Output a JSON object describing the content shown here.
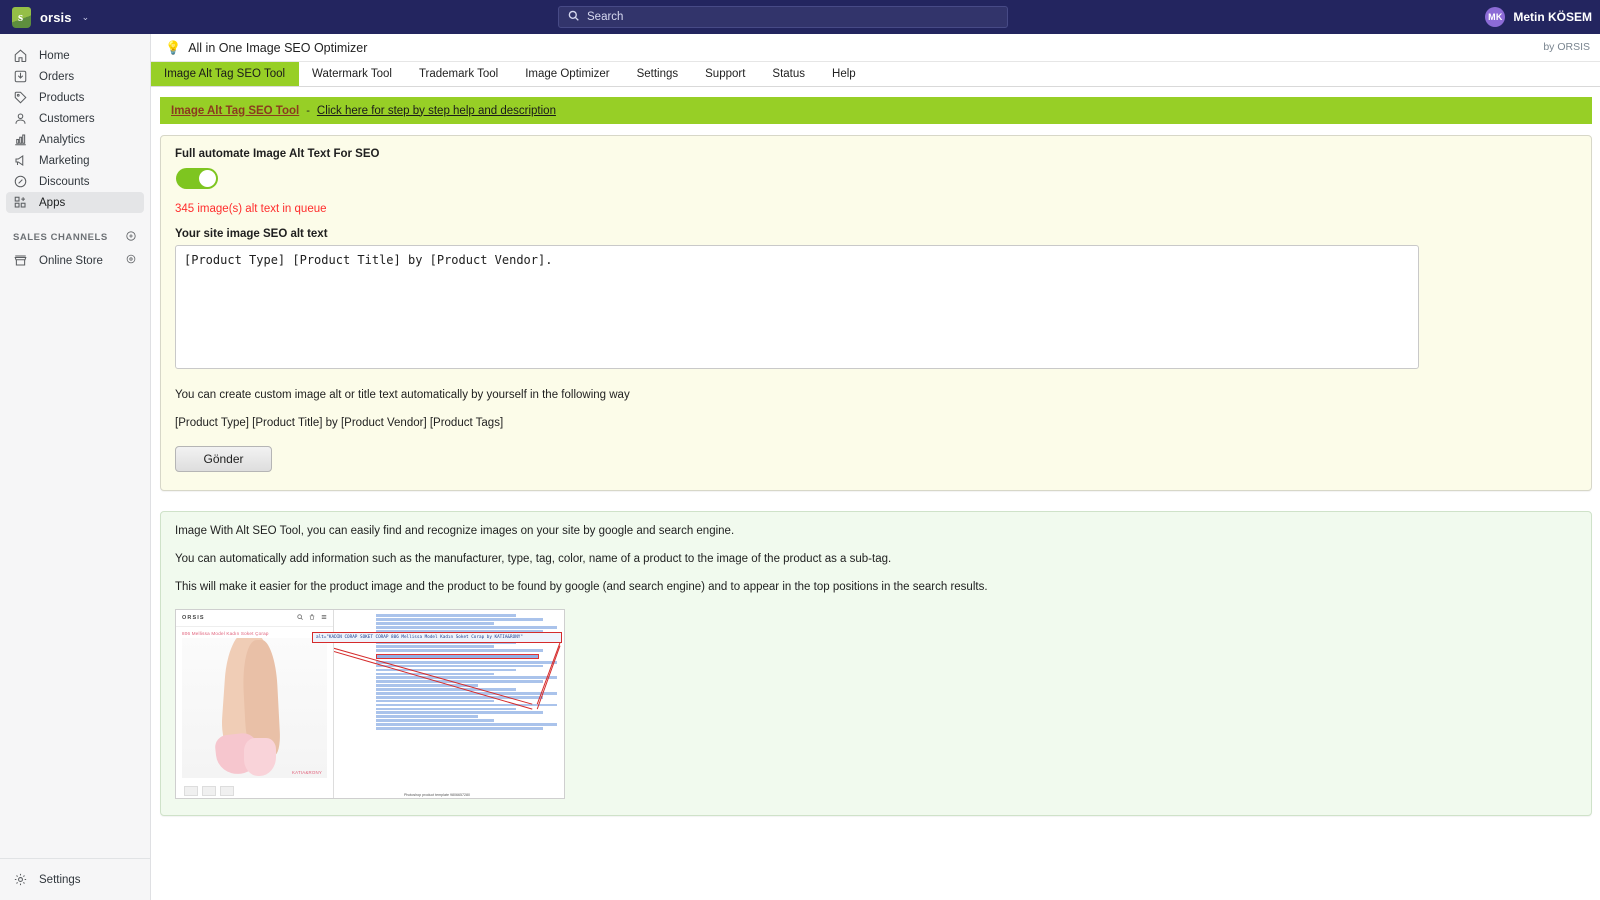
{
  "topbar": {
    "store_name": "orsis",
    "chevron": "⌄",
    "search_placeholder": "Search",
    "search_icon": "search-icon",
    "user_initials": "MK",
    "user_name": "Metin KÖSEM"
  },
  "sidebar": {
    "items": [
      {
        "label": "Home",
        "icon": "home-icon"
      },
      {
        "label": "Orders",
        "icon": "orders-icon"
      },
      {
        "label": "Products",
        "icon": "tag-icon"
      },
      {
        "label": "Customers",
        "icon": "person-icon"
      },
      {
        "label": "Analytics",
        "icon": "chart-icon"
      },
      {
        "label": "Marketing",
        "icon": "megaphone-icon"
      },
      {
        "label": "Discounts",
        "icon": "discount-icon"
      },
      {
        "label": "Apps",
        "icon": "apps-icon"
      }
    ],
    "active_item": "Apps",
    "section_title": "SALES CHANNELS",
    "add_channel_icon": "plus-circle-icon",
    "channels": [
      {
        "label": "Online Store",
        "icon": "storefront-icon",
        "action_icon": "view-icon"
      }
    ],
    "bottom": {
      "label": "Settings",
      "icon": "gear-icon"
    }
  },
  "app": {
    "icon": "lightbulb-icon",
    "title": "All in One Image SEO Optimizer",
    "by_brand": "by ORSIS",
    "tabs": [
      {
        "label": "Image Alt Tag SEO Tool",
        "active": true
      },
      {
        "label": "Watermark Tool",
        "active": false
      },
      {
        "label": "Trademark Tool",
        "active": false
      },
      {
        "label": "Image Optimizer",
        "active": false
      },
      {
        "label": "Settings",
        "active": false
      },
      {
        "label": "Support",
        "active": false
      },
      {
        "label": "Status",
        "active": false
      },
      {
        "label": "Help",
        "active": false
      }
    ]
  },
  "banner": {
    "title": "Image Alt Tag SEO Tool",
    "separator": "-",
    "link": "Click here for step by step help and description"
  },
  "form": {
    "automate_label": "Full automate Image Alt Text For SEO",
    "toggle_state": "on",
    "queue_text": "345 image(s) alt text in queue",
    "queue_color": "#ff2d2d",
    "alt_text_label": "Your site image SEO alt text",
    "alt_text_value": "[Product Type] [Product Title] by [Product Vendor].",
    "help_line_1": "You can create custom image alt or title text automatically by yourself in the following way",
    "help_line_2": "[Product Type] [Product Title] by [Product Vendor] [Product Tags]",
    "submit_label": "Gönder"
  },
  "info": {
    "line_1": "Image With Alt SEO Tool, you can easily find and recognize images on your site by google and search engine.",
    "line_2": "You can automatically add information such as the manufacturer, type, tag, color, name of a product to the image of the product as a sub-tag.",
    "line_3": "This will make it easier for the product image and the product to be found by google (and search engine) and to appear in the top positions in the search results.",
    "illustration": {
      "store_logo": "ORSIS",
      "store_icons": [
        "search-icon",
        "bag-icon",
        "menu-icon"
      ],
      "product_title": "806 Mellissa Model Kadın Soket Çorap",
      "watermark": "KATIA&RONY",
      "callout_code": "alt=\"KADIN CORAP SOKET CORAP 806 Mellissa Model Kadın Soket Corap by KATIA&RONY\"",
      "source_footer": "Photoshop product template 9806657280"
    }
  },
  "colors": {
    "accent_green": "#97cf26",
    "toggle_green": "#7ec520",
    "topbar_navy": "#23255f",
    "card_cream": "#fcfce9",
    "card_mint": "#f1faee",
    "alert_red": "#ff2d2d"
  }
}
